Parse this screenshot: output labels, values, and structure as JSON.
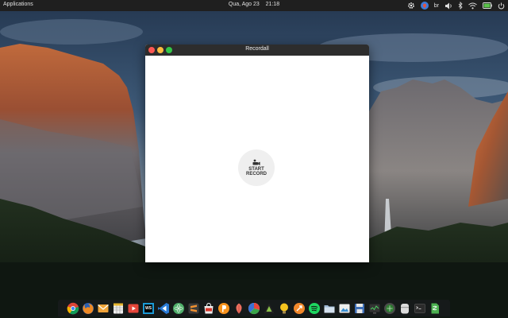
{
  "top_panel": {
    "applications_label": "Applications",
    "date": "Qua, Ago 23",
    "time": "21:18",
    "keyboard_layout": "br"
  },
  "window": {
    "title": "Recordall",
    "record_button_label": "START\nRECORD"
  },
  "tray_icons": [
    "settings-icon",
    "avatar-icon",
    "keyboard-layout",
    "volume-icon",
    "bluetooth-icon",
    "wifi-icon",
    "battery-icon",
    "power-icon"
  ],
  "dock": {
    "items": [
      "chrome",
      "firefox",
      "mail",
      "spreadsheet",
      "video-player",
      "webstorm",
      "vscode",
      "atom",
      "sublime-text",
      "ubuntu-software",
      "postman",
      "feather-app",
      "color-picker",
      "android-studio",
      "ideas-app",
      "sublime-merge",
      "spotify",
      "file-manager",
      "photo-viewer",
      "save-app",
      "system-monitor",
      "media-player",
      "package-app",
      "terminal",
      "document-app"
    ]
  },
  "colors": {
    "panel_bg": "#1f1f1f",
    "titlebar_bg": "#2d2d2d",
    "close": "#fc5753",
    "minimize": "#fdbc40",
    "maximize": "#33c748",
    "record_button_bg": "#efefef"
  }
}
